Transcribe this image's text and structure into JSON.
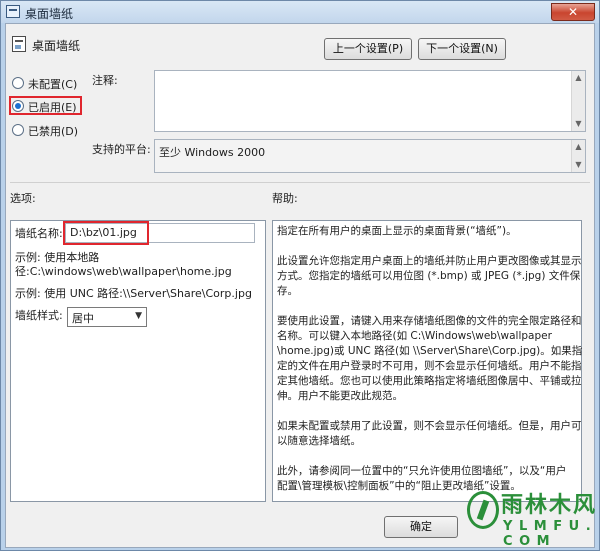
{
  "window": {
    "title": "桌面墙纸",
    "close_glyph": "✕"
  },
  "header": {
    "title": "桌面墙纸",
    "prev_button": "上一个设置(P)",
    "next_button": "下一个设置(N)"
  },
  "options": {
    "not_configured": "未配置(C)",
    "enabled": "已启用(E)",
    "disabled": "已禁用(D)",
    "selected": "enabled"
  },
  "comment": {
    "label": "注释:",
    "value": ""
  },
  "platform": {
    "label": "支持的平台:",
    "value": "至少 Windows 2000"
  },
  "sections": {
    "options_label": "选项:",
    "help_label": "帮助:"
  },
  "wallpaper": {
    "name_label": "墙纸名称:",
    "name_value": "D:\\bz\\01.jpg",
    "example_local_1": "示例: 使用本地路",
    "example_local_2": "径:C:\\windows\\web\\wallpaper\\home.jpg",
    "example_unc": "示例: 使用 UNC 路径:\\\\Server\\Share\\Corp.jpg",
    "style_label": "墙纸样式:",
    "style_value": "居中"
  },
  "help": {
    "lines": [
      "指定在所有用户的桌面上显示的桌面背景(“墙纸”)。",
      "",
      "此设置允许您指定用户桌面上的墙纸并防止用户更改图像或其显示",
      "方式。您指定的墙纸可以用位图 (*.bmp) 或 JPEG (*.jpg) 文件保",
      "存。",
      "",
      "要使用此设置，请键入用来存储墙纸图像的文件的完全限定路径和",
      "名称。可以键入本地路径(如 C:\\Windows\\web\\wallpaper",
      "\\home.jpg)或 UNC 路径(如 \\\\Server\\Share\\Corp.jpg)。如果指",
      "定的文件在用户登录时不可用，则不会显示任何墙纸。用户不能指",
      "定其他墙纸。您也可以使用此策略指定将墙纸图像居中、平铺或拉",
      "伸。用户不能更改此规范。",
      "",
      "如果未配置或禁用了此设置，则不会显示任何墙纸。但是，用户可",
      "以随意选择墙纸。",
      "",
      "此外，请参阅同一位置中的“只允许使用位图墙纸”，以及“用户",
      "配置\\管理模板\\控制面板”中的“阻止更改墙纸”设置。"
    ]
  },
  "footer": {
    "ok_button": "确定"
  },
  "watermark": {
    "text": "雨林木风",
    "sub": "Y L M F U . C O M"
  }
}
